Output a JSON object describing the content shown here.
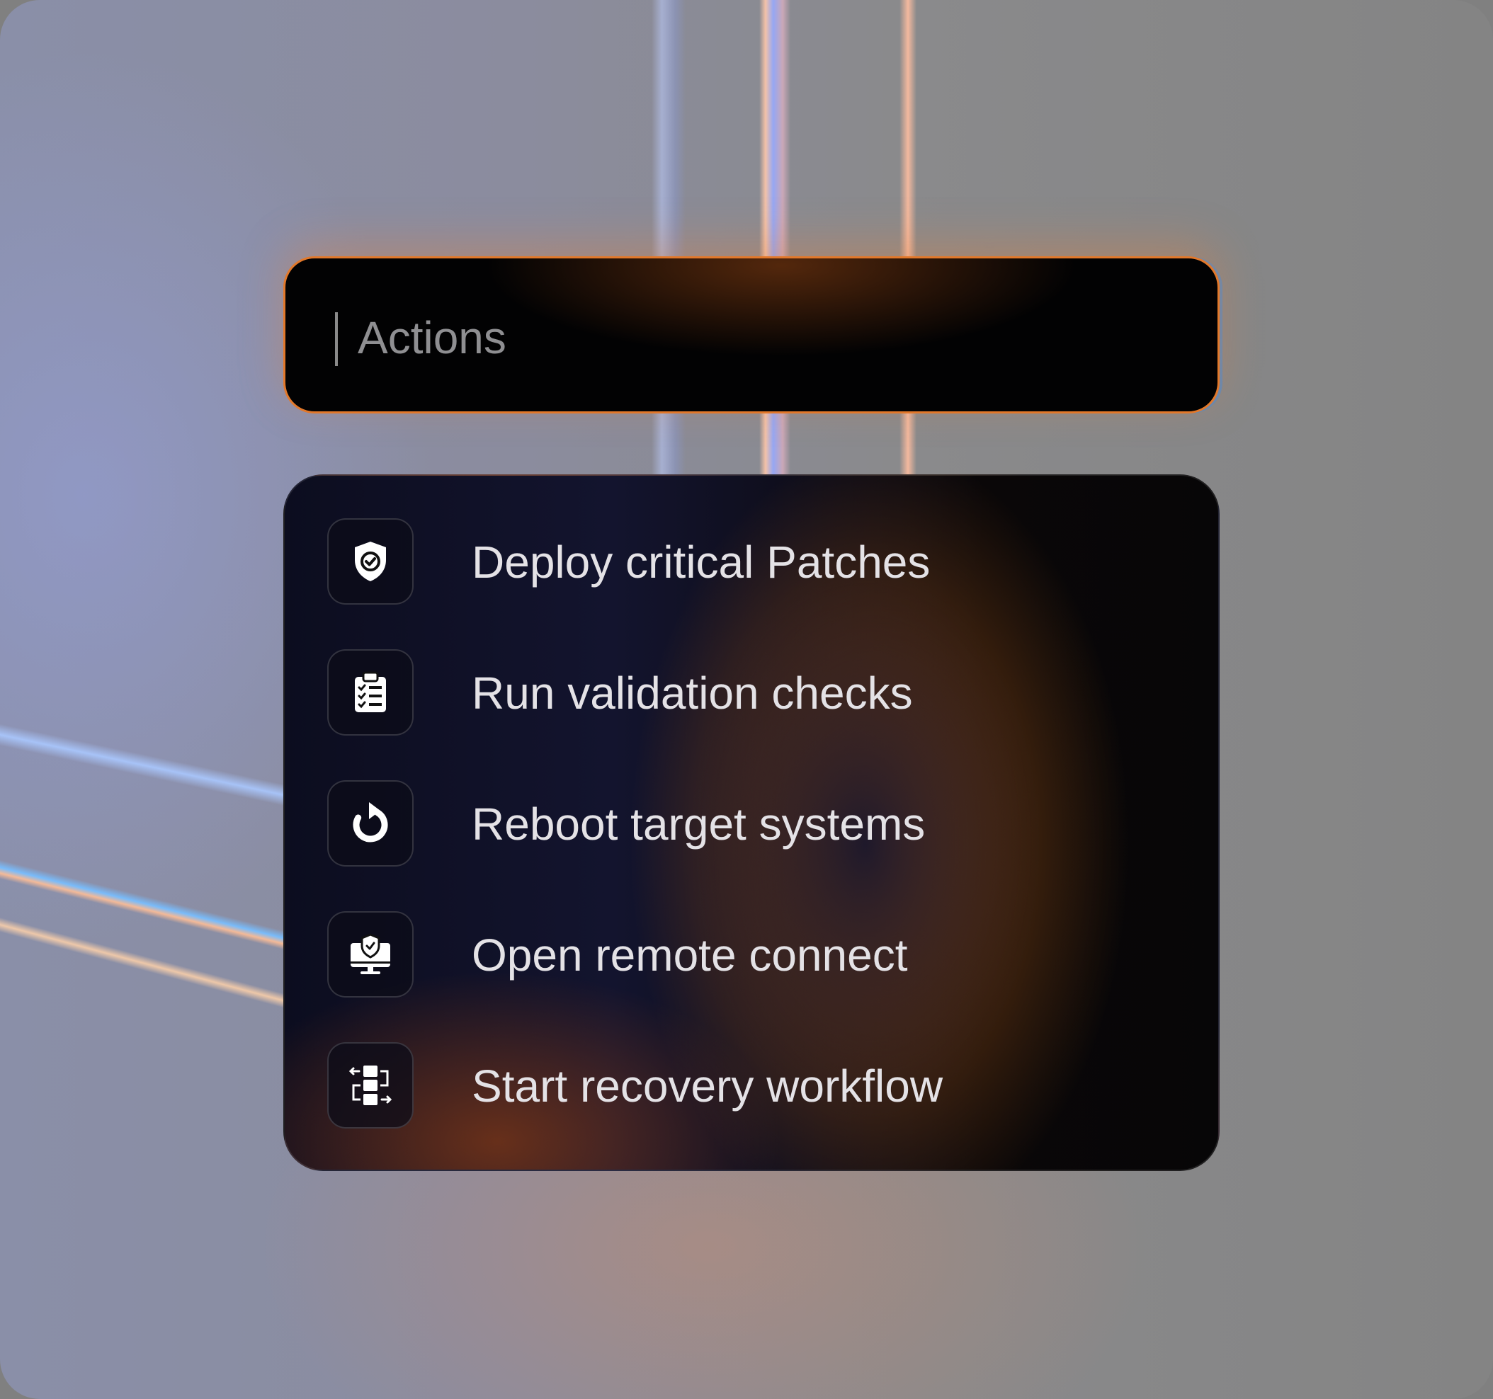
{
  "search": {
    "placeholder": "Actions"
  },
  "actions": [
    {
      "label": "Deploy critical Patches",
      "icon": "shield-check-icon"
    },
    {
      "label": "Run validation checks",
      "icon": "clipboard-checklist-icon"
    },
    {
      "label": "Reboot target systems",
      "icon": "refresh-icon"
    },
    {
      "label": "Open remote connect",
      "icon": "monitor-shield-icon"
    },
    {
      "label": "Start recovery workflow",
      "icon": "workflow-icon"
    }
  ],
  "colors": {
    "search_border": "#e2782a",
    "panel_background": "#0c0d1f",
    "text": "#e4e2e6"
  }
}
